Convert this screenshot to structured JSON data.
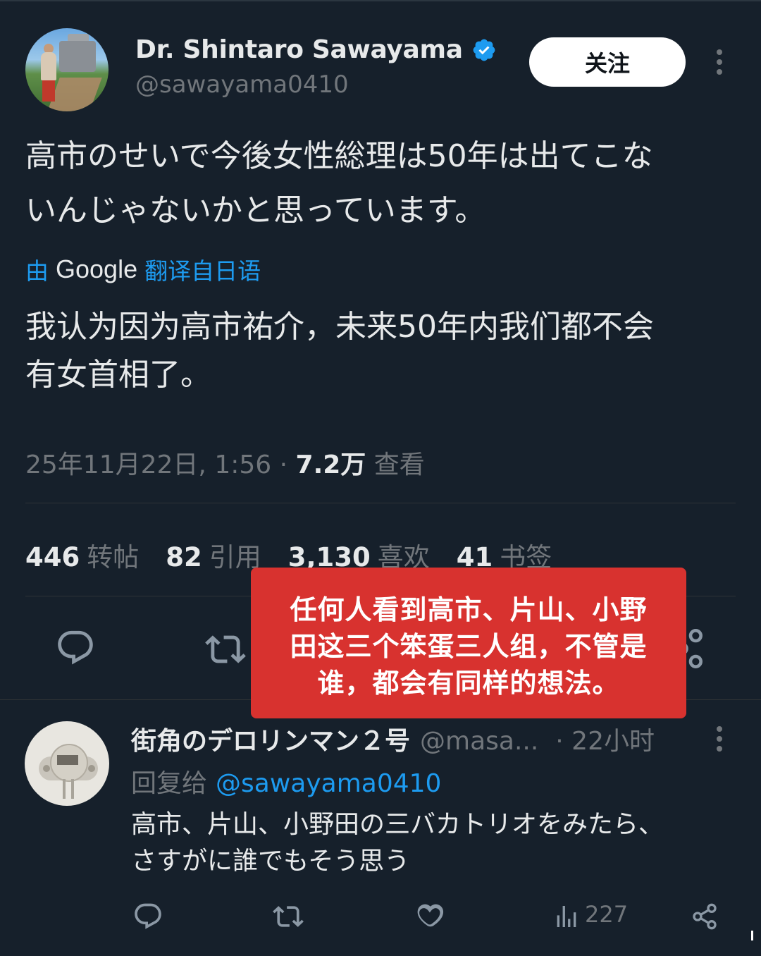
{
  "tweet": {
    "author_name": "Dr. Shintaro Sawayama",
    "author_handle": "@sawayama0410",
    "follow_label": "关注",
    "text_line1": "高市のせいで今後女性総理は50年は出てこな",
    "text_line2": "いんじゃないかと思っています。",
    "translate_prefix": "由",
    "translate_brand": "Google",
    "translate_suffix": "翻译自日语",
    "translated_line1": "我认为因为高市祐介，未来50年内我们都不会",
    "translated_line2": "有女首相了。",
    "timestamp": "25年11月22日, 1:56",
    "separator": "·",
    "views_count": "7.2万",
    "views_label": "查看",
    "stats": [
      {
        "count": "446",
        "label": "转帖"
      },
      {
        "count": "82",
        "label": "引用"
      },
      {
        "count": "3,130",
        "label": "喜欢"
      },
      {
        "count": "41",
        "label": "书签"
      }
    ]
  },
  "overlay": {
    "line1": "任何人看到高市、片山、小野",
    "line2": "田这三个笨蛋三人组，不管是",
    "line3": "谁，都会有同样的想法。"
  },
  "reply": {
    "author_name": "街角のデロリンマン２号",
    "author_handle": "@masa...",
    "time": "· 22小时",
    "reply_to_label": "回复给",
    "reply_to_handle": "@sawayama0410",
    "text_line1": "高市、片山、小野田の三バカトリオをみたら、",
    "text_line2": "さすがに誰でもそう思う",
    "views": "227"
  },
  "colors": {
    "background": "#16202b",
    "accent": "#1d9bf0",
    "overlay": "#d8322f"
  }
}
